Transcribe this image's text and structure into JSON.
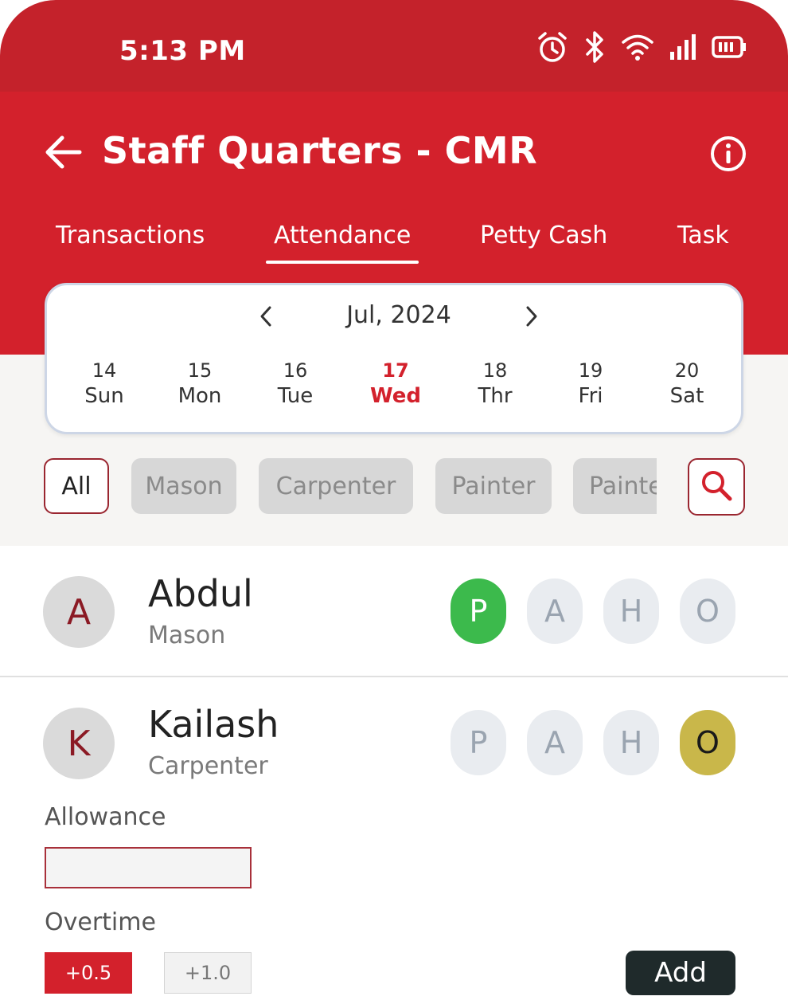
{
  "status_bar": {
    "time": "5:13 PM",
    "icons": [
      "alarm-icon",
      "bluetooth-icon",
      "wifi-icon",
      "signal-icon",
      "battery-icon"
    ]
  },
  "header": {
    "title": "Staff Quarters - CMR",
    "back_icon": "arrow-left-icon",
    "info_icon": "info-icon",
    "color": "#d3212c"
  },
  "tabs": [
    {
      "label": "Transactions",
      "active": false
    },
    {
      "label": "Attendance",
      "active": true
    },
    {
      "label": "Petty Cash",
      "active": false
    },
    {
      "label": "Task",
      "active": false
    }
  ],
  "calendar": {
    "month": "Jul, 2024",
    "days": [
      {
        "num": "14",
        "name": "Sun"
      },
      {
        "num": "15",
        "name": "Mon"
      },
      {
        "num": "16",
        "name": "Tue"
      },
      {
        "num": "17",
        "name": "Wed",
        "selected": true
      },
      {
        "num": "18",
        "name": "Thr"
      },
      {
        "num": "19",
        "name": "Fri"
      },
      {
        "num": "20",
        "name": "Sat"
      }
    ]
  },
  "filters": {
    "chips": [
      "All",
      "Mason",
      "Carpenter",
      "Painter",
      "Painter"
    ],
    "active": "All",
    "search_icon": "search-icon"
  },
  "employees": [
    {
      "initial": "A",
      "name": "Abdul",
      "role": "Mason",
      "status": "P"
    },
    {
      "initial": "K",
      "name": "Kailash",
      "role": "Carpenter",
      "status": "O"
    }
  ],
  "status_options": [
    "P",
    "A",
    "H",
    "O"
  ],
  "details": {
    "allowance_label": "Allowance",
    "allowance_value": "",
    "overtime_label": "Overtime",
    "overtime_options": [
      "+0.5",
      "+1.0"
    ],
    "overtime_selected": "+0.5",
    "add_label": "Add"
  },
  "colors": {
    "present": "#3cba4c",
    "other": "#c9b74a",
    "accent": "#d3212c",
    "add_button": "#1f2a2b"
  }
}
